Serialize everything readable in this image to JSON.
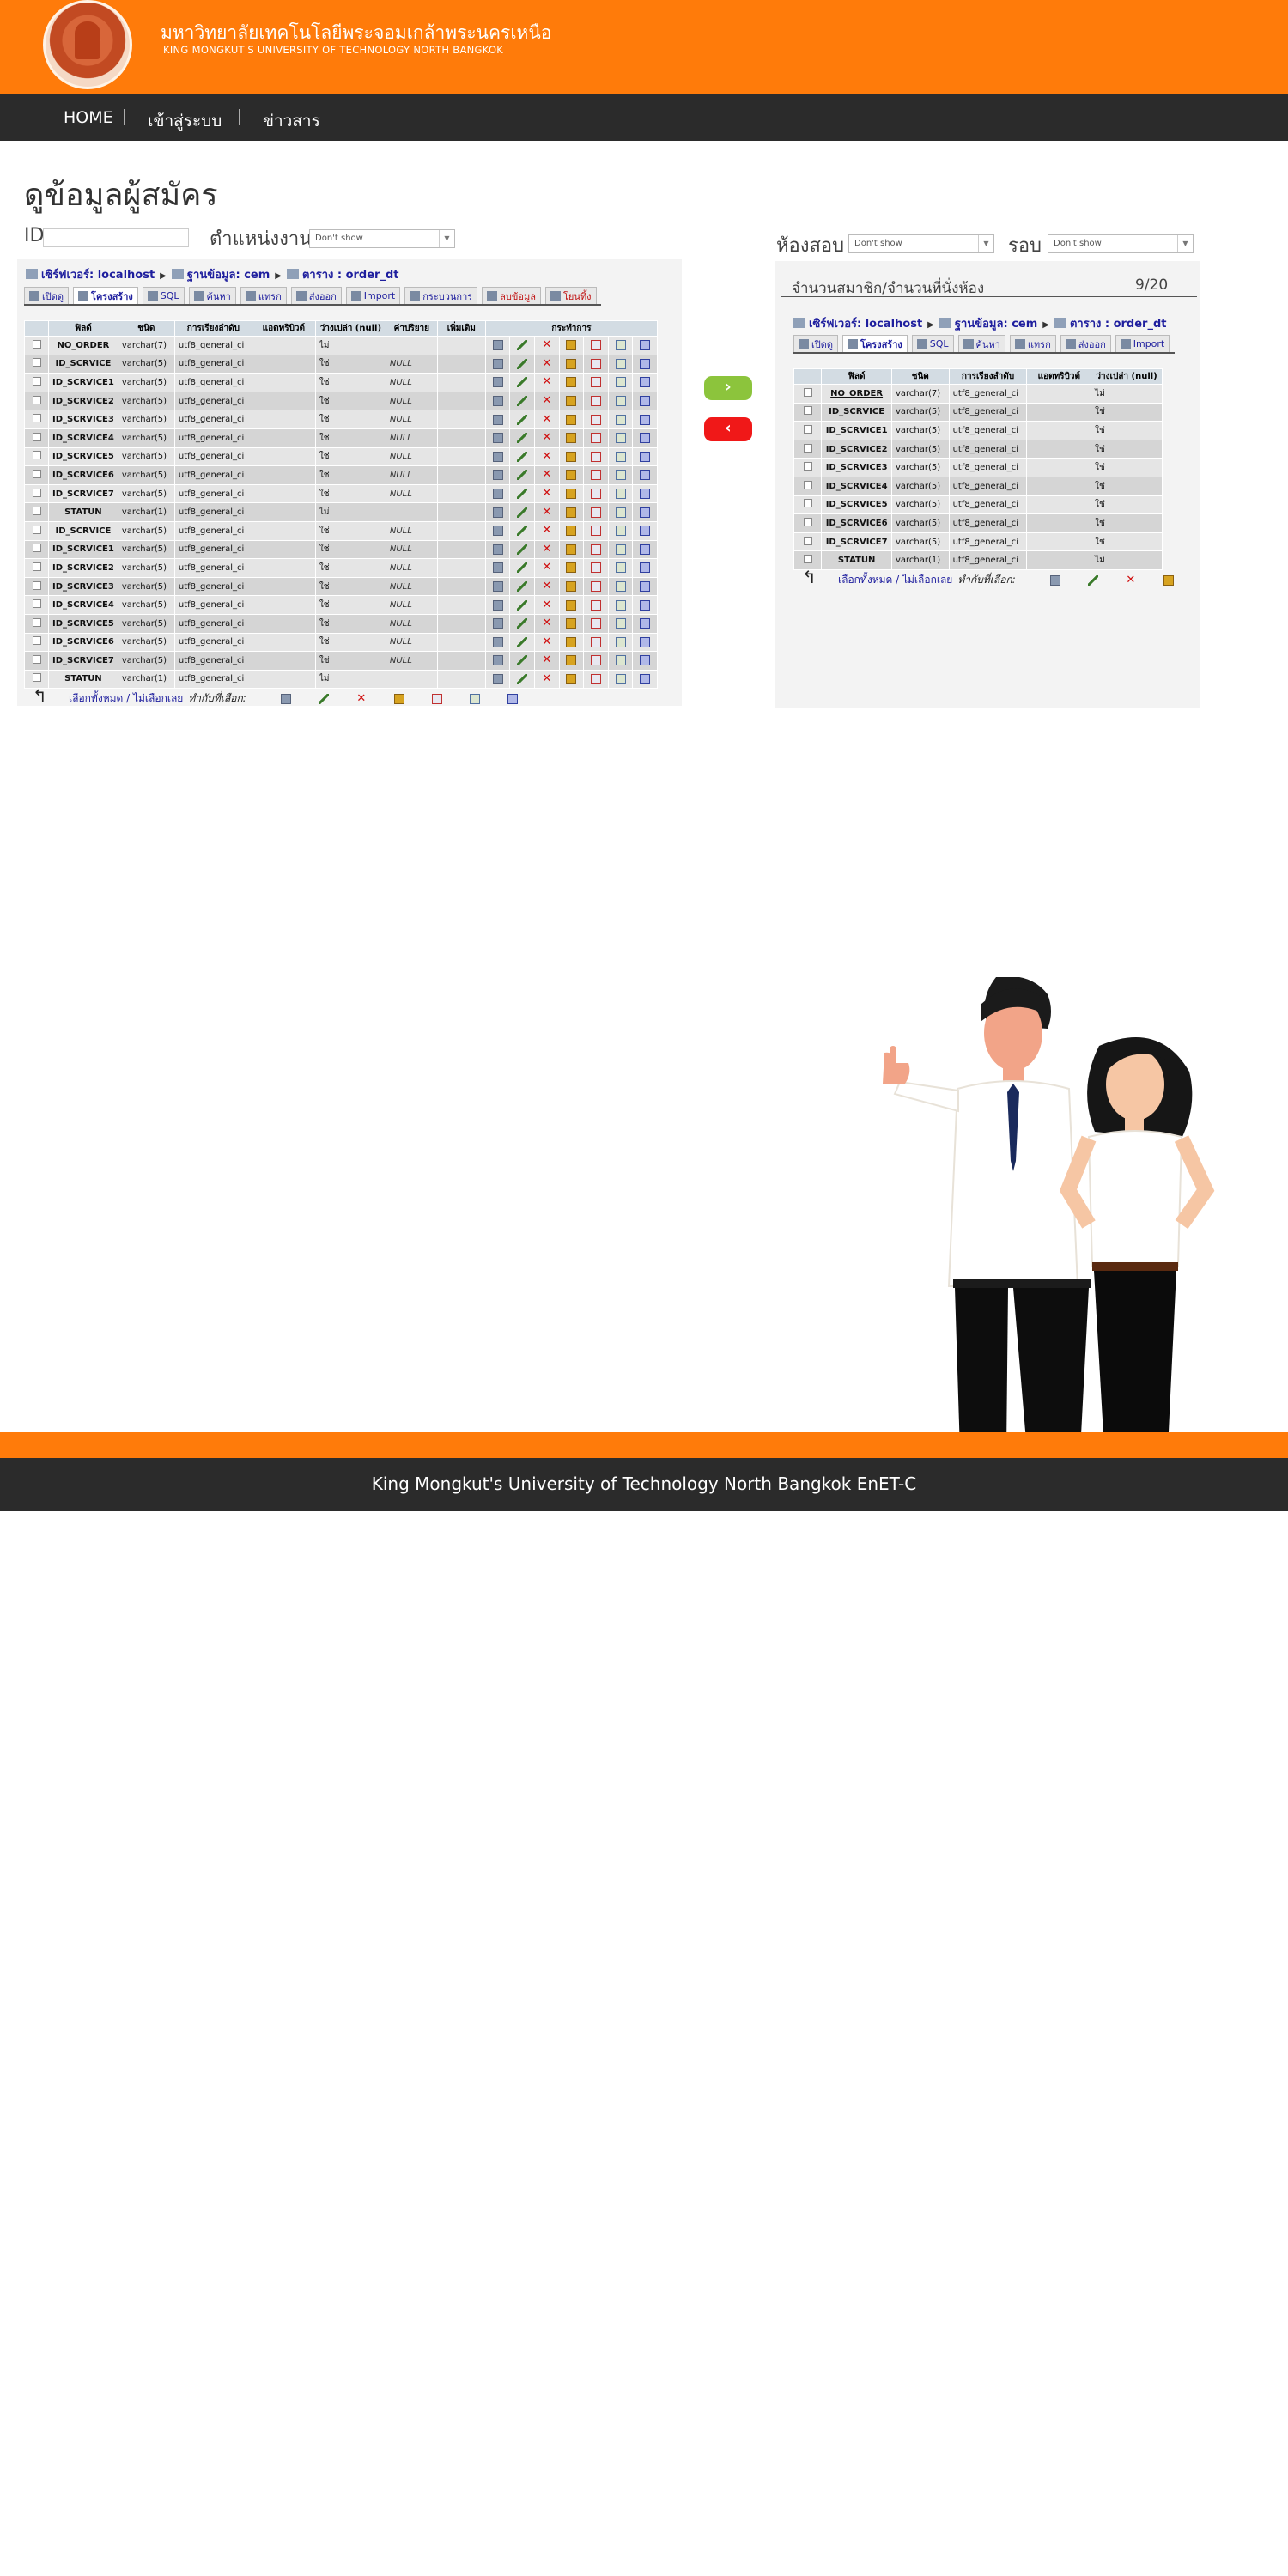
{
  "header": {
    "university_th": "มหาวิทยาลัยเทคโนโลยีพระจอมเกล้าพระนครเหนือ",
    "university_en": "KING MONGKUT'S UNIVERSITY OF TECHNOLOGY NORTH BANGKOK"
  },
  "nav": {
    "items": [
      "HOME",
      "เข้าสู่ระบบ",
      "ข่าวสาร"
    ],
    "separator": "|"
  },
  "page": {
    "title": "ดูข้อมูลผู้สมัคร"
  },
  "filters": {
    "id_label": "ID",
    "id_value": "",
    "position_label": "ตำแหน่งงาน",
    "position_value": "Don't show",
    "room_label": "ห้องสอบ",
    "room_value": "Don't show",
    "round_label": "รอบ",
    "round_value": "Don't show"
  },
  "breadcrumb": {
    "server": "เซิร์ฟเวอร์: localhost",
    "database": "ฐานข้อมูล: cem",
    "table": "ตาราง : order_dt"
  },
  "tabs_left": [
    {
      "label": "เปิดดู",
      "style": "normal"
    },
    {
      "label": "โครงสร้าง",
      "style": "active"
    },
    {
      "label": "SQL",
      "style": "normal"
    },
    {
      "label": "ค้นหา",
      "style": "normal"
    },
    {
      "label": "แทรก",
      "style": "normal"
    },
    {
      "label": "ส่งออก",
      "style": "normal"
    },
    {
      "label": "Import",
      "style": "normal"
    },
    {
      "label": "กระบวนการ",
      "style": "normal"
    },
    {
      "label": "ลบข้อมูล",
      "style": "red"
    },
    {
      "label": "โยนทิ้ง",
      "style": "red"
    }
  ],
  "tabs_right": [
    {
      "label": "เปิดดู",
      "style": "normal"
    },
    {
      "label": "โครงสร้าง",
      "style": "active"
    },
    {
      "label": "SQL",
      "style": "normal"
    },
    {
      "label": "ค้นหา",
      "style": "normal"
    },
    {
      "label": "แทรก",
      "style": "normal"
    },
    {
      "label": "ส่งออก",
      "style": "normal"
    },
    {
      "label": "Import",
      "style": "normal"
    }
  ],
  "table_headers": {
    "field": "ฟิลด์",
    "type": "ชนิด",
    "collation": "การเรียงลำดับ",
    "attributes": "แอตทริบิวต์",
    "null": "ว่างเปล่า (null)",
    "default": "ค่าปริยาย",
    "extra": "เพิ่มเติม",
    "action": "กระทำการ"
  },
  "left_rows": [
    {
      "field": "NO_ORDER",
      "type": "varchar(7)",
      "collation": "utf8_general_ci",
      "null": "ไม่",
      "default": "",
      "pk": true
    },
    {
      "field": "ID_SCRVICE",
      "type": "varchar(5)",
      "collation": "utf8_general_ci",
      "null": "ใช่",
      "default": "NULL",
      "pk": false
    },
    {
      "field": "ID_SCRVICE1",
      "type": "varchar(5)",
      "collation": "utf8_general_ci",
      "null": "ใช่",
      "default": "NULL",
      "pk": false
    },
    {
      "field": "ID_SCRVICE2",
      "type": "varchar(5)",
      "collation": "utf8_general_ci",
      "null": "ใช่",
      "default": "NULL",
      "pk": false
    },
    {
      "field": "ID_SCRVICE3",
      "type": "varchar(5)",
      "collation": "utf8_general_ci",
      "null": "ใช่",
      "default": "NULL",
      "pk": false
    },
    {
      "field": "ID_SCRVICE4",
      "type": "varchar(5)",
      "collation": "utf8_general_ci",
      "null": "ใช่",
      "default": "NULL",
      "pk": false
    },
    {
      "field": "ID_SCRVICE5",
      "type": "varchar(5)",
      "collation": "utf8_general_ci",
      "null": "ใช่",
      "default": "NULL",
      "pk": false
    },
    {
      "field": "ID_SCRVICE6",
      "type": "varchar(5)",
      "collation": "utf8_general_ci",
      "null": "ใช่",
      "default": "NULL",
      "pk": false
    },
    {
      "field": "ID_SCRVICE7",
      "type": "varchar(5)",
      "collation": "utf8_general_ci",
      "null": "ใช่",
      "default": "NULL",
      "pk": false
    },
    {
      "field": "STATUN",
      "type": "varchar(1)",
      "collation": "utf8_general_ci",
      "null": "ไม่",
      "default": "",
      "pk": false
    },
    {
      "field": "ID_SCRVICE",
      "type": "varchar(5)",
      "collation": "utf8_general_ci",
      "null": "ใช่",
      "default": "NULL",
      "pk": false
    },
    {
      "field": "ID_SCRVICE1",
      "type": "varchar(5)",
      "collation": "utf8_general_ci",
      "null": "ใช่",
      "default": "NULL",
      "pk": false
    },
    {
      "field": "ID_SCRVICE2",
      "type": "varchar(5)",
      "collation": "utf8_general_ci",
      "null": "ใช่",
      "default": "NULL",
      "pk": false
    },
    {
      "field": "ID_SCRVICE3",
      "type": "varchar(5)",
      "collation": "utf8_general_ci",
      "null": "ใช่",
      "default": "NULL",
      "pk": false
    },
    {
      "field": "ID_SCRVICE4",
      "type": "varchar(5)",
      "collation": "utf8_general_ci",
      "null": "ใช่",
      "default": "NULL",
      "pk": false
    },
    {
      "field": "ID_SCRVICE5",
      "type": "varchar(5)",
      "collation": "utf8_general_ci",
      "null": "ใช่",
      "default": "NULL",
      "pk": false
    },
    {
      "field": "ID_SCRVICE6",
      "type": "varchar(5)",
      "collation": "utf8_general_ci",
      "null": "ใช่",
      "default": "NULL",
      "pk": false
    },
    {
      "field": "ID_SCRVICE7",
      "type": "varchar(5)",
      "collation": "utf8_general_ci",
      "null": "ใช่",
      "default": "NULL",
      "pk": false
    },
    {
      "field": "STATUN",
      "type": "varchar(1)",
      "collation": "utf8_general_ci",
      "null": "ไม่",
      "default": "",
      "pk": false
    }
  ],
  "right_rows": [
    {
      "field": "NO_ORDER",
      "type": "varchar(7)",
      "collation": "utf8_general_ci",
      "null": "ไม่",
      "pk": true
    },
    {
      "field": "ID_SCRVICE",
      "type": "varchar(5)",
      "collation": "utf8_general_ci",
      "null": "ใช่",
      "pk": false
    },
    {
      "field": "ID_SCRVICE1",
      "type": "varchar(5)",
      "collation": "utf8_general_ci",
      "null": "ใช่",
      "pk": false
    },
    {
      "field": "ID_SCRVICE2",
      "type": "varchar(5)",
      "collation": "utf8_general_ci",
      "null": "ใช่",
      "pk": false
    },
    {
      "field": "ID_SCRVICE3",
      "type": "varchar(5)",
      "collation": "utf8_general_ci",
      "null": "ใช่",
      "pk": false
    },
    {
      "field": "ID_SCRVICE4",
      "type": "varchar(5)",
      "collation": "utf8_general_ci",
      "null": "ใช่",
      "pk": false
    },
    {
      "field": "ID_SCRVICE5",
      "type": "varchar(5)",
      "collation": "utf8_general_ci",
      "null": "ใช่",
      "pk": false
    },
    {
      "field": "ID_SCRVICE6",
      "type": "varchar(5)",
      "collation": "utf8_general_ci",
      "null": "ใช่",
      "pk": false
    },
    {
      "field": "ID_SCRVICE7",
      "type": "varchar(5)",
      "collation": "utf8_general_ci",
      "null": "ใช่",
      "pk": false
    },
    {
      "field": "STATUN",
      "type": "varchar(1)",
      "collation": "utf8_general_ci",
      "null": "ไม่",
      "pk": false
    }
  ],
  "table_footer": {
    "select_all": "เลือกทั้งหมด / ไม่เลือกเลย",
    "with_selected": "ทำกับที่เลือก:"
  },
  "seat_info": {
    "label": "จำนวนสมาชิก/จำนวนที่นั่งห้อง",
    "value": "9/20"
  },
  "buttons": {
    "move_right": "›",
    "move_left": "‹"
  },
  "footer": {
    "text": "King Mongkut's University of Technology North Bangkok EnET-C"
  },
  "colors": {
    "brand_orange": "#ff7b0a",
    "nav_dark": "#2b2b2b",
    "button_green": "#8cc43c",
    "button_red": "#f01818"
  }
}
